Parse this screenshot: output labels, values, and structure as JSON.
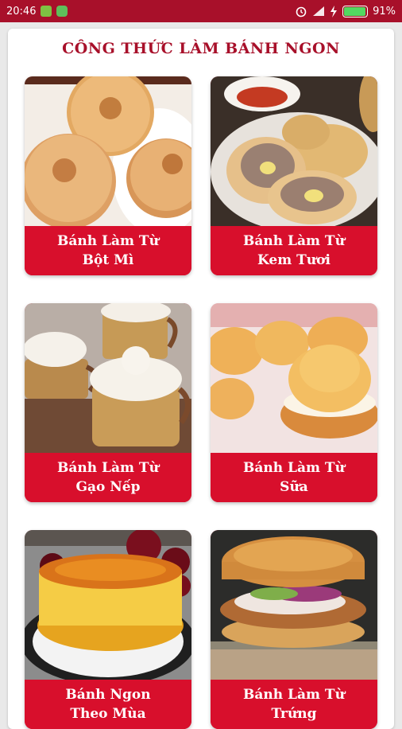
{
  "status_bar": {
    "time": "20:46",
    "battery_percent": "91%",
    "battery_level": 0.91,
    "icons": [
      "sim-icon",
      "notification-icon",
      "alarm-icon",
      "signal-icon",
      "charging-icon",
      "battery-icon"
    ]
  },
  "header": {
    "title": "CÔNG THỨC LÀM BÁNH NGON"
  },
  "categories": [
    {
      "line1": "Bánh Làm Từ",
      "line2": "Bột Mì"
    },
    {
      "line1": "Bánh Làm Từ",
      "line2": "Kem Tươi"
    },
    {
      "line1": "Bánh Làm Từ",
      "line2": "Gạo Nếp"
    },
    {
      "line1": "Bánh Làm Từ",
      "line2": "Sữa"
    },
    {
      "line1": "Bánh Ngon",
      "line2": "Theo Mùa"
    },
    {
      "line1": "Bánh Làm Từ",
      "line2": "Trứng"
    }
  ],
  "colors": {
    "status_bar": "#a8102a",
    "title": "#a8102a",
    "label_bg": "#d80f2c"
  }
}
